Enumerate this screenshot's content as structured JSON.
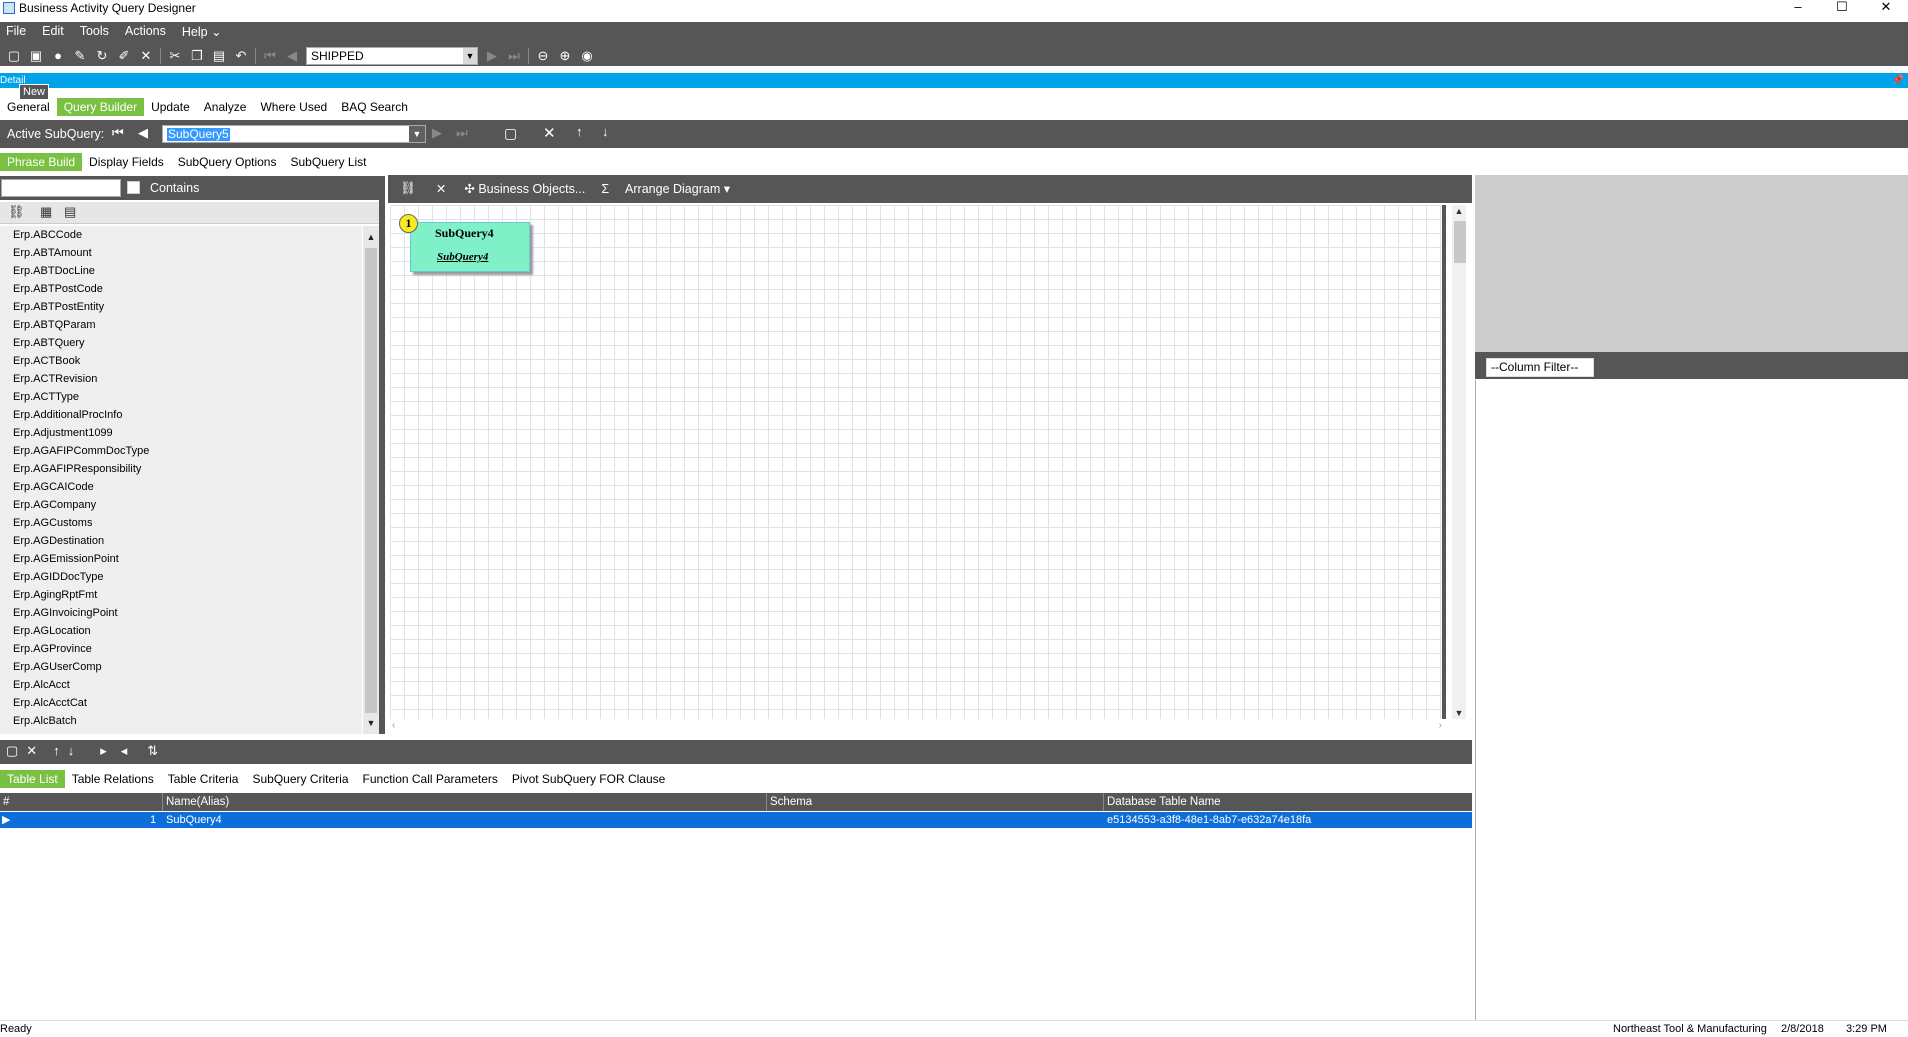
{
  "window": {
    "title": "Business Activity Query Designer",
    "minimize": "–",
    "maximize": "☐",
    "close": "✕"
  },
  "menu": [
    "File",
    "Edit",
    "Tools",
    "Actions",
    "Help"
  ],
  "menu_more": "⌄",
  "toolbar": {
    "key_value": "SHIPPED"
  },
  "detail_bar": {
    "label": "Detail"
  },
  "tooltip": "New",
  "main_tabs": [
    "General",
    "Query Builder",
    "Update",
    "Analyze",
    "Where Used",
    "BAQ Search"
  ],
  "active_subquery": {
    "label": "Active SubQuery:",
    "value": "SubQuery5"
  },
  "sub_tabs": [
    "Phrase Build",
    "Display Fields",
    "SubQuery Options",
    "SubQuery List"
  ],
  "search": {
    "contains_label": "Contains"
  },
  "table_list": [
    "Erp.ABCCode",
    "Erp.ABTAmount",
    "Erp.ABTDocLine",
    "Erp.ABTPostCode",
    "Erp.ABTPostEntity",
    "Erp.ABTQParam",
    "Erp.ABTQuery",
    "Erp.ACTBook",
    "Erp.ACTRevision",
    "Erp.ACTType",
    "Erp.AdditionalProcInfo",
    "Erp.Adjustment1099",
    "Erp.AGAFIPCommDocType",
    "Erp.AGAFIPResponsibility",
    "Erp.AGCAICode",
    "Erp.AGCompany",
    "Erp.AGCustoms",
    "Erp.AGDestination",
    "Erp.AGEmissionPoint",
    "Erp.AGIDDocType",
    "Erp.AgingRptFmt",
    "Erp.AGInvoicingPoint",
    "Erp.AGLocation",
    "Erp.AGProvince",
    "Erp.AGUserComp",
    "Erp.AlcAcct",
    "Erp.AlcAcctCat",
    "Erp.AlcBatch"
  ],
  "diagram_toolbar": {
    "business_objects": "Business Objects...",
    "sigma": "Σ",
    "arrange": "Arrange Diagram"
  },
  "diagram_node": {
    "badge": "1",
    "name": "SubQuery4",
    "alias": "SubQuery4"
  },
  "column_filter": "--Column Filter--",
  "bottom_tabs": [
    "Table List",
    "Table Relations",
    "Table Criteria",
    "SubQuery Criteria",
    "Function Call Parameters",
    "Pivot SubQuery FOR Clause"
  ],
  "grid": {
    "headers": [
      "#",
      "Name(Alias)",
      "Schema",
      "Database Table Name"
    ],
    "rows": [
      {
        "num": "1",
        "name": "SubQuery4",
        "schema": "",
        "db_table": "e5134553-a3f8-48e1-8ab7-e632a74e18fa"
      }
    ]
  },
  "status": {
    "left": "Ready",
    "company": "Northeast Tool & Manufacturing",
    "date": "2/8/2018",
    "time": "3:29 PM"
  }
}
